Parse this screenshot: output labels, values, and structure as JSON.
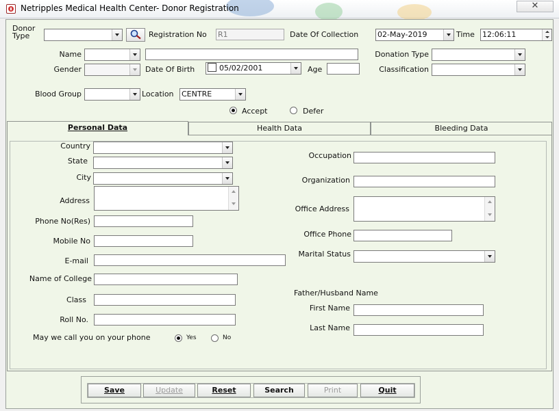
{
  "window": {
    "title": "Netripples Medical Health Center- Donor Registration",
    "close_glyph": "✕"
  },
  "top": {
    "donor_type_label_1": "Donor",
    "donor_type_label_2": "Type",
    "donor_type_value": "",
    "registration_no_label": "Registration No",
    "registration_no_value": "R1",
    "date_of_collection_label": "Date Of Collection",
    "date_of_collection_value": "02-May-2019",
    "time_label": "Time",
    "time_value": "12:06:11",
    "name_label": "Name",
    "name_prefix_value": "",
    "name_value": "",
    "donation_type_label": "Donation Type",
    "donation_type_value": "",
    "gender_label": "Gender",
    "gender_value": "",
    "dob_label": "Date Of Birth",
    "dob_value": "05/02/2001",
    "age_label": "Age",
    "age_value": "",
    "classification_label": "Classification",
    "classification_value": "",
    "blood_group_label": "Blood Group",
    "blood_group_value": "",
    "location_label": "Location",
    "location_value": "CENTRE",
    "accept_label": "Accept",
    "defer_label": "Defer",
    "accept_selected": true
  },
  "tabs": [
    {
      "label": "Personal Data",
      "active": true
    },
    {
      "label": "Health Data",
      "active": false
    },
    {
      "label": "Bleeding Data",
      "active": false
    }
  ],
  "personal": {
    "country_label": "Country",
    "state_label": "State",
    "city_label": "City",
    "address_label": "Address",
    "phone_res_label": "Phone No(Res)",
    "mobile_label": "Mobile No",
    "email_label": "E-mail",
    "college_label": "Name of College",
    "class_label": "Class",
    "roll_label": "Roll No.",
    "call_question": "May we call you on your phone",
    "yes_label": "Yes",
    "no_label": "No",
    "yes_selected": true,
    "occupation_label": "Occupation",
    "organization_label": "Organization",
    "office_address_label": "Office Address",
    "office_phone_label": "Office Phone",
    "marital_status_label": "Marital Status",
    "father_husband_label": "Father/Husband Name",
    "first_name_label": "First Name",
    "last_name_label": "Last Name"
  },
  "buttons": [
    {
      "label": "Save",
      "enabled": true
    },
    {
      "label": "Update",
      "enabled": false
    },
    {
      "label": "Reset",
      "enabled": true
    },
    {
      "label": "Search",
      "enabled": true
    },
    {
      "label": "Print",
      "enabled": false
    },
    {
      "label": "Quit",
      "enabled": true
    }
  ],
  "colors": {
    "form_background": "#f0f6e8",
    "title_bar": "#ffffff"
  }
}
